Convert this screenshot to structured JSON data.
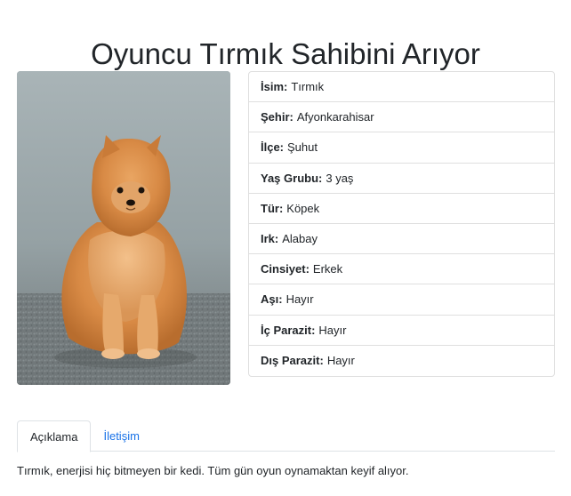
{
  "page": {
    "title": "Oyuncu Tırmık Sahibini Arıyor"
  },
  "photo": {
    "subject": "pomeranian-puppy"
  },
  "info": [
    {
      "key": "İsim:",
      "value": "Tırmık"
    },
    {
      "key": "Şehir:",
      "value": "Afyonkarahisar"
    },
    {
      "key": "İlçe:",
      "value": "Şuhut"
    },
    {
      "key": "Yaş Grubu:",
      "value": "3 yaş"
    },
    {
      "key": "Tür:",
      "value": "Köpek"
    },
    {
      "key": "Irk:",
      "value": "Alabay"
    },
    {
      "key": "Cinsiyet:",
      "value": "Erkek"
    },
    {
      "key": "Aşı:",
      "value": "Hayır"
    },
    {
      "key": "İç Parazit:",
      "value": "Hayır"
    },
    {
      "key": "Dış Parazit:",
      "value": "Hayır"
    }
  ],
  "tabs": [
    {
      "label": "Açıklama",
      "active": true
    },
    {
      "label": "İletişim",
      "active": false
    }
  ],
  "description": "Tırmık, enerjisi hiç bitmeyen bir kedi. Tüm gün oyun oynamaktan keyif alıyor.",
  "colors": {
    "link": "#1a73e8",
    "border": "#dfdfdf",
    "text": "#212529"
  }
}
